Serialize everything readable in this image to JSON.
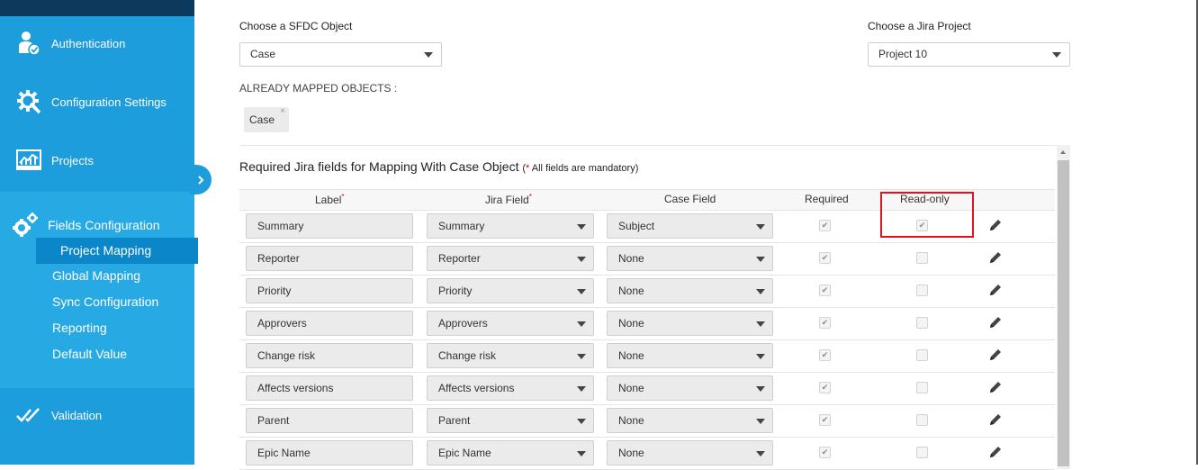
{
  "sidebar": {
    "items": [
      {
        "label": "Authentication",
        "icon": "user-check-icon"
      },
      {
        "label": "Configuration Settings",
        "icon": "gear-wrench-icon"
      },
      {
        "label": "Projects",
        "icon": "chart-monitor-icon"
      }
    ],
    "group": {
      "label": "Fields Configuration",
      "icon": "gears-icon",
      "sub_items": [
        "Project Mapping",
        "Global Mapping",
        "Sync Configuration",
        "Reporting",
        "Default Value"
      ],
      "active": "Project Mapping"
    },
    "bottom_items": [
      {
        "label": "Validation",
        "icon": "double-check-icon"
      }
    ],
    "colors": {
      "bg": "#1d9ddc",
      "group_bg": "#27aae4",
      "active_bg": "#0b86c9"
    }
  },
  "sfdc_object": {
    "label": "Choose a SFDC Object",
    "value": "Case"
  },
  "jira_project": {
    "label": "Choose a Jira Project",
    "value": "Project 10"
  },
  "mapped_objects": {
    "title": "ALREADY MAPPED OBJECTS :",
    "items": [
      "Case"
    ],
    "remove_symbol": "×"
  },
  "section": {
    "title": "Required Jira fields for Mapping With Case Object",
    "note_open": "(",
    "note_star": "*",
    "note_text": " All fields are mandatory)"
  },
  "table": {
    "headers": {
      "label": "Label",
      "jira_field": "Jira Field",
      "case_field": "Case Field",
      "required": "Required",
      "read_only": "Read-only"
    },
    "required_marker": "*",
    "rows": [
      {
        "label": "Summary",
        "jira_field": "Summary",
        "case_field": "Subject",
        "required": true,
        "read_only": true
      },
      {
        "label": "Reporter",
        "jira_field": "Reporter",
        "case_field": "None",
        "required": true,
        "read_only": false
      },
      {
        "label": "Priority",
        "jira_field": "Priority",
        "case_field": "None",
        "required": true,
        "read_only": false
      },
      {
        "label": "Approvers",
        "jira_field": "Approvers",
        "case_field": "None",
        "required": true,
        "read_only": false
      },
      {
        "label": "Change risk",
        "jira_field": "Change risk",
        "case_field": "None",
        "required": true,
        "read_only": false
      },
      {
        "label": "Affects versions",
        "jira_field": "Affects versions",
        "case_field": "None",
        "required": true,
        "read_only": false
      },
      {
        "label": "Parent",
        "jira_field": "Parent",
        "case_field": "None",
        "required": true,
        "read_only": false
      },
      {
        "label": "Epic Name",
        "jira_field": "Epic Name",
        "case_field": "None",
        "required": true,
        "read_only": false
      }
    ]
  },
  "highlight_color": "#e0141c"
}
